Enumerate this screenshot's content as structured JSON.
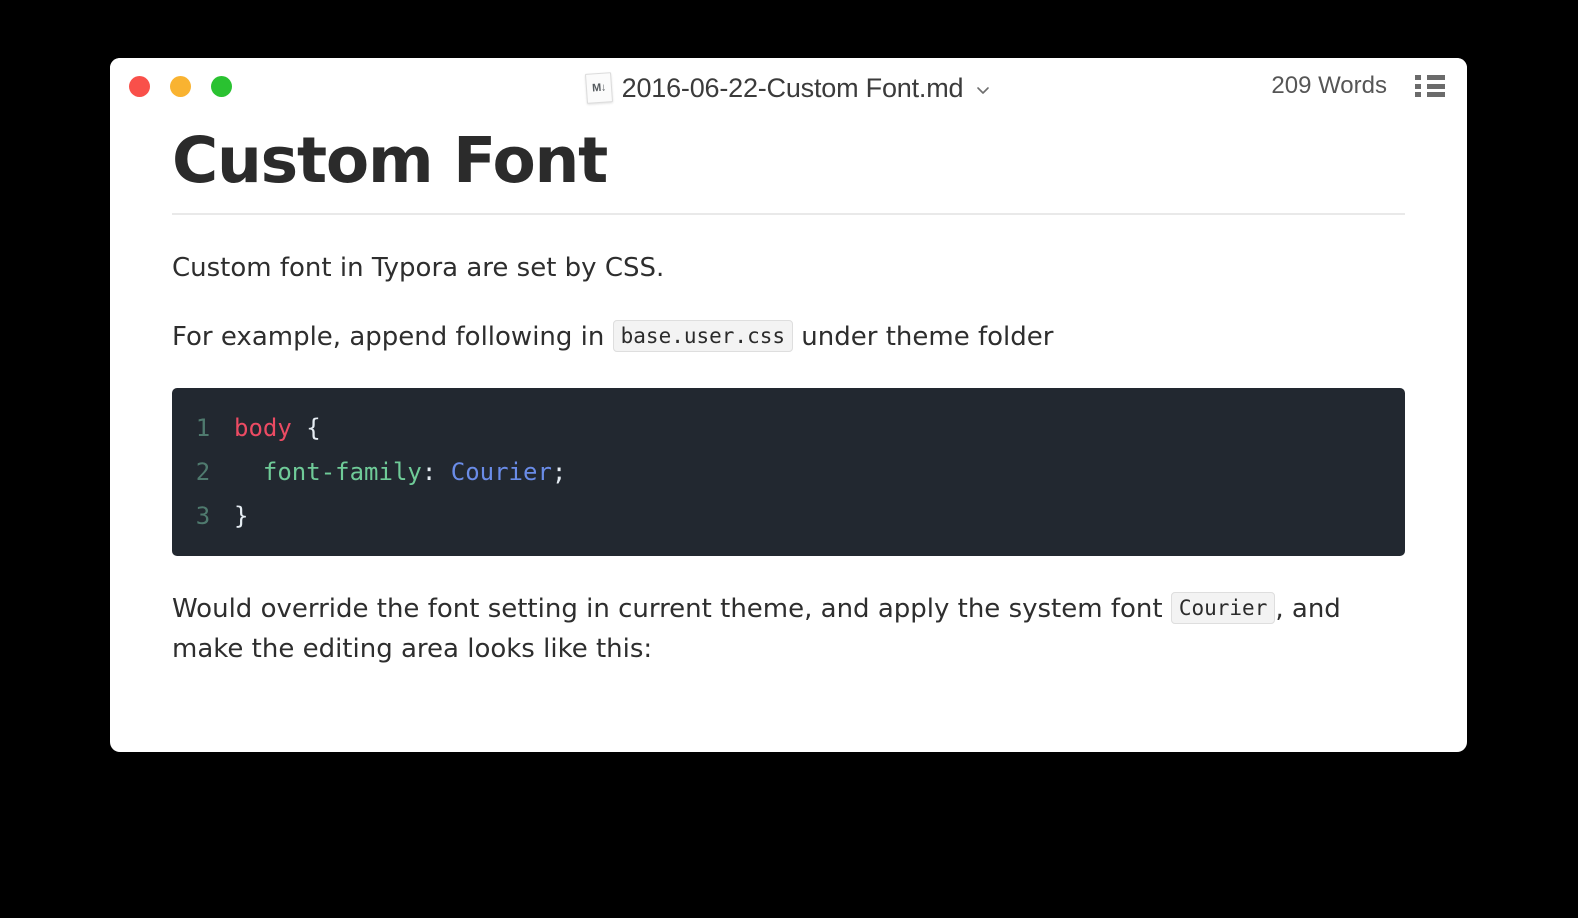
{
  "window": {
    "traffic_lights": [
      {
        "name": "close",
        "color": "#f9504a"
      },
      {
        "name": "minimize",
        "color": "#f9b331"
      },
      {
        "name": "maximize",
        "color": "#2ac231"
      }
    ],
    "titlebar": {
      "file_icon": "markdown-file-icon",
      "file_icon_glyph": "M↓",
      "title": "2016-06-22-Custom Font.md",
      "dropdown_icon": "chevron-down-icon",
      "word_count": "209 Words",
      "outline_icon": "outline-list-icon"
    }
  },
  "document": {
    "heading": "Custom Font",
    "paragraph_1": "Custom font in Typora are set by CSS.",
    "paragraph_2": {
      "before": "For example, append following in ",
      "code": "base.user.css",
      "after": " under theme folder"
    },
    "code_block": {
      "language": "css",
      "lines": [
        {
          "number": "1",
          "tokens": [
            {
              "text": "body",
              "type": "selector"
            },
            {
              "text": " {",
              "type": "punct"
            }
          ]
        },
        {
          "number": "2",
          "tokens": [
            {
              "text": "  font-family",
              "type": "prop"
            },
            {
              "text": ": ",
              "type": "punct"
            },
            {
              "text": "Courier",
              "type": "value"
            },
            {
              "text": ";",
              "type": "punct"
            }
          ]
        },
        {
          "number": "3",
          "tokens": [
            {
              "text": "}",
              "type": "punct"
            }
          ]
        }
      ],
      "colors": {
        "background": "#222830",
        "line_number": "#4f7a6e",
        "selector": "#ec4b63",
        "property": "#6fcb98",
        "value": "#6a8ce8",
        "punctuation": "#e6edf3"
      }
    },
    "paragraph_3": {
      "before": "Would override the font setting in current theme, and apply the system font ",
      "code": "Courier",
      "after": ", and make the editing area looks like this:"
    }
  }
}
